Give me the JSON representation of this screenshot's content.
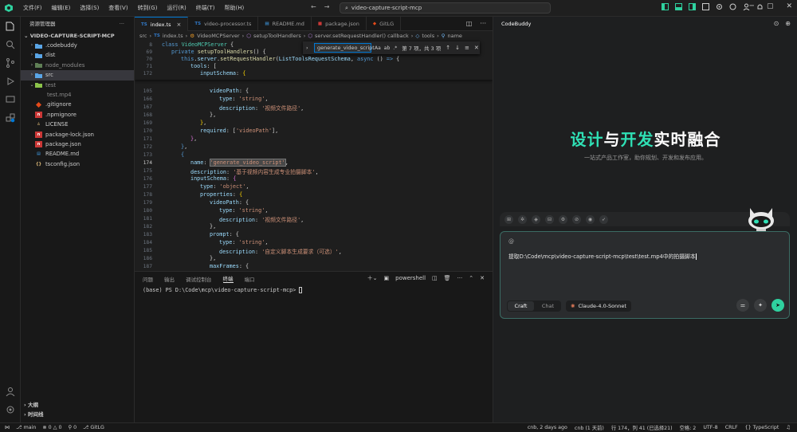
{
  "menu": [
    "文件(F)",
    "编辑(E)",
    "选择(S)",
    "查看(V)",
    "转到(G)",
    "运行(R)",
    "终端(T)",
    "帮助(H)"
  ],
  "search_text": "video-capture-script-mcp",
  "explorer": {
    "header": "资源管理器",
    "root": "VIDEO-CAPTURE-SCRIPT-MCP",
    "items": [
      {
        "label": ".codebuddy"
      },
      {
        "label": "dist"
      },
      {
        "label": "node_modules"
      },
      {
        "label": "src"
      },
      {
        "label": "test"
      },
      {
        "label": "test.mp4"
      },
      {
        "label": ".gitignore"
      },
      {
        "label": ".npmignore"
      },
      {
        "label": "LICENSE"
      },
      {
        "label": "package-lock.json"
      },
      {
        "label": "package.json"
      },
      {
        "label": "README.md"
      },
      {
        "label": "tsconfig.json"
      }
    ],
    "outline": "大纲",
    "timeline": "时间线"
  },
  "tabs": [
    {
      "icon": "TS",
      "label": "index.ts"
    },
    {
      "icon": "TS",
      "label": "video-processor.ts"
    },
    {
      "icon": "",
      "label": "README.md"
    },
    {
      "icon": "",
      "label": "package.json"
    },
    {
      "icon": "",
      "label": "GitLG"
    }
  ],
  "breadcrumbs": [
    "src",
    "index.ts",
    "VideoMCPServer",
    "setupToolHandlers",
    "server.setRequestHandler() callback",
    "tools",
    "name"
  ],
  "find": {
    "query": "generate_video_script",
    "opt_case": "Aa",
    "opt_word": "ab",
    "opt_regex": ".*",
    "count": "第 7 项，共 3 项"
  },
  "code": {
    "sticky_numbers": [
      "8",
      "69",
      "70",
      "71",
      "172"
    ],
    "numbers": [
      "105",
      "166",
      "167",
      "168",
      "169",
      "170",
      "171",
      "172",
      "173",
      "174",
      "175",
      "176",
      "177",
      "178",
      "179",
      "180",
      "181",
      "182",
      "183",
      "184",
      "185",
      "186",
      "187"
    ],
    "current_line": "174",
    "strings": {
      "s_string": "'string'",
      "s_path": "'视频文件路径'",
      "s_vp": "'videoPath'",
      "s_name": "'generate_video_script'",
      "s_desc": "'基于视频内容生成专业拍摄脚本'",
      "s_obj": "'object'",
      "s_prompt": "'自定义脚本生成要求（可选）'"
    },
    "kw": {
      "class": "class",
      "private": "private",
      "this": "this",
      "async": "async",
      "cls_name": "VideoMCPServer",
      "fn_setup": "setupToolHandlers",
      "fn_set": "setRequestHandler",
      "schema": "ListToolsRequestSchema",
      "server": "server",
      "tools": "tools",
      "inputSchema": "inputSchema",
      "properties": "properties",
      "videoPath": "videoPath",
      "type": "type",
      "description": "description",
      "required": "required",
      "name": "name",
      "prompt": "prompt",
      "maxFrames": "maxFrames"
    }
  },
  "panel": {
    "tabs": [
      "问题",
      "输出",
      "调试控制台",
      "终端",
      "端口"
    ],
    "shell": "powershell",
    "prompt": "(base) PS D:\\Code\\mcp\\video-capture-script-mcp>"
  },
  "codebuddy": {
    "tab": "CodeBuddy",
    "hero_a": "设计",
    "hero_b": "与",
    "hero_c": "开发",
    "hero_d": "实时融合",
    "subtitle": "一站式产品工作室，助你规划、开发和发布应用。",
    "message": "提取D:\\Code\\mcp\\video-capture-script-mcp\\test\\test.mp4中的拍摄脚本",
    "mode_craft": "Craft",
    "mode_chat": "Chat",
    "model": "Claude-4.0-Sonnet"
  },
  "status": {
    "branch": "main",
    "errors": "0",
    "warnings": "0",
    "ports": "0",
    "gitlg": "GitLG",
    "left_right": [
      "cnb, 2 days ago",
      "cnb (1 天前)",
      "行 174，列 41 (已选择21)",
      "空格: 2",
      "UTF-8",
      "CRLF",
      "{} TypeScript"
    ]
  },
  "colors": {
    "accent": "#0078d4",
    "brand": "#2fe0b5",
    "send": "#2fd19f"
  }
}
